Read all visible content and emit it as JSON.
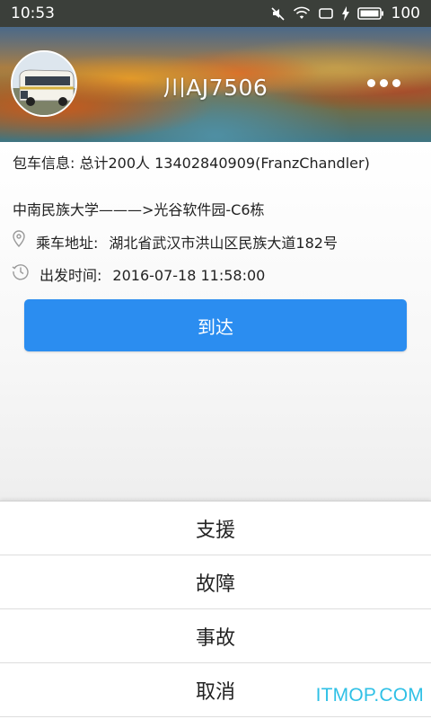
{
  "status_bar": {
    "time": "10:53",
    "battery": "100",
    "icons": [
      "mute-icon",
      "wifi-icon",
      "screen-icon",
      "charging-icon",
      "battery-icon"
    ]
  },
  "header": {
    "plate": "川AJ7506",
    "avatar_icon": "bus-avatar",
    "more_icon": "more-horizontal-icon"
  },
  "info": {
    "charter_line": "包车信息: 总计200人  13402840909(FranzChandler)",
    "route": "中南民族大学———>光谷软件园-C6栋",
    "pickup_label": "乘车地址:",
    "pickup_value": "湖北省武汉市洪山区民族大道182号",
    "depart_label": "出发时间:",
    "depart_value": "2016-07-18 11:58:00"
  },
  "actions": {
    "arrive": "到达"
  },
  "sheet": {
    "items": [
      "支援",
      "故障",
      "事故",
      "取消"
    ]
  },
  "watermark": "ITMOP.COM",
  "colors": {
    "status_bar": "#3b3f3a",
    "primary_button": "#2b8df0",
    "watermark": "#2fc0e6"
  }
}
